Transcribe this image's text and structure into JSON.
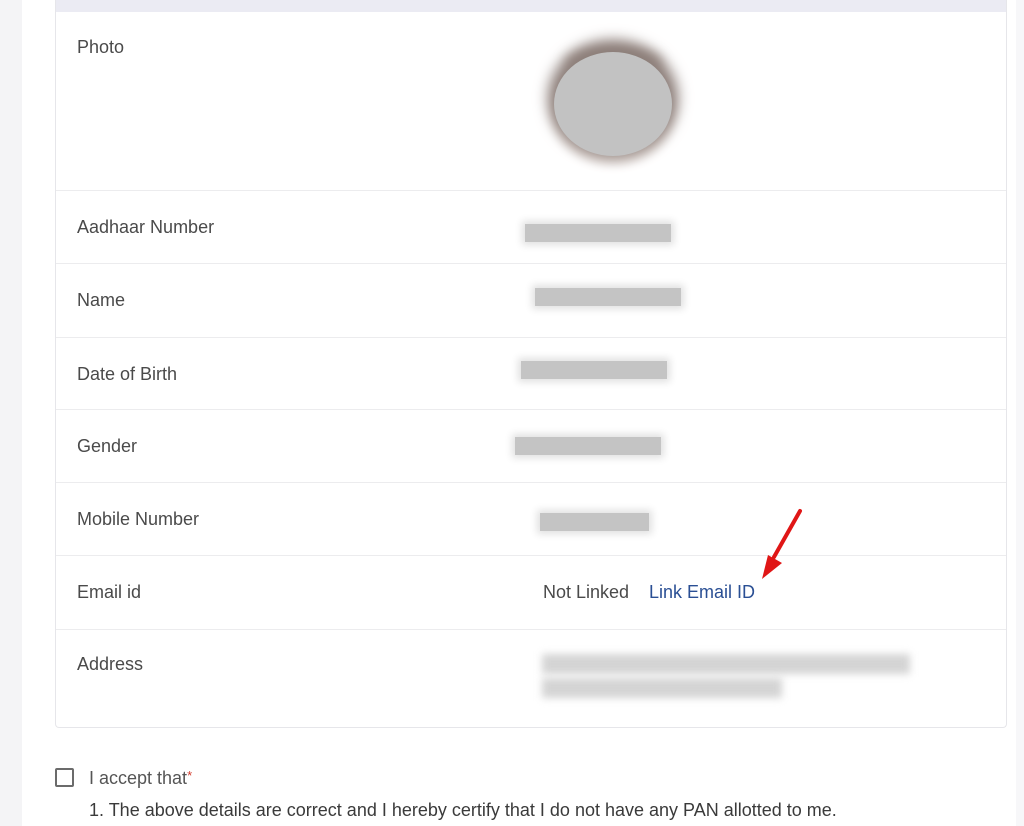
{
  "details": {
    "rows": [
      {
        "label": "Photo"
      },
      {
        "label": "Aadhaar Number"
      },
      {
        "label": "Name"
      },
      {
        "label": "Date of Birth"
      },
      {
        "label": "Gender"
      },
      {
        "label": "Mobile Number"
      },
      {
        "label": "Email id",
        "status": "Not Linked",
        "action_label": "Link Email ID"
      },
      {
        "label": "Address"
      }
    ]
  },
  "consent": {
    "accept_label": "I accept that",
    "required_marker": "*",
    "line1": "1. The above details are correct and I hereby certify that I do not have any PAN allotted to me."
  },
  "colors": {
    "link": "#2a4f94",
    "annotation_arrow": "#e01616",
    "required": "#d23a2c"
  },
  "icons": {
    "annotation": "red-arrow-icon"
  }
}
